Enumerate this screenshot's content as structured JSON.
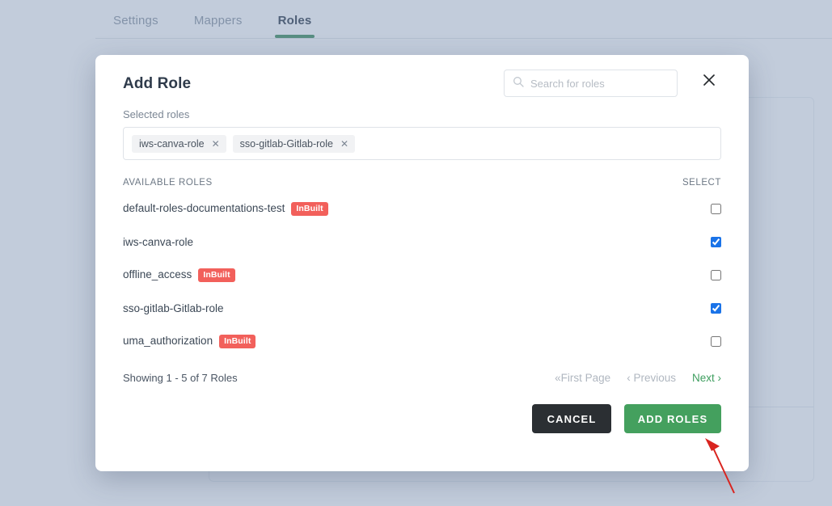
{
  "background": {
    "tabs": [
      {
        "label": "Settings",
        "active": false
      },
      {
        "label": "Mappers",
        "active": false
      },
      {
        "label": "Roles",
        "active": true
      }
    ],
    "accent_color": "#3e8e5e"
  },
  "modal": {
    "title": "Add Role",
    "close_icon": "close-icon",
    "search": {
      "icon": "search-icon",
      "placeholder": "Search for roles",
      "value": ""
    },
    "selected": {
      "label": "Selected roles",
      "chips": [
        {
          "label": "iws-canva-role",
          "remove_icon": "close-icon"
        },
        {
          "label": "sso-gitlab-Gitlab-role",
          "remove_icon": "close-icon"
        }
      ]
    },
    "table": {
      "columns": [
        "AVAILABLE ROLES",
        "SELECT"
      ],
      "rows": [
        {
          "name": "default-roles-documentations-test",
          "badge": "InBuilt",
          "checked": false
        },
        {
          "name": "iws-canva-role",
          "badge": "",
          "checked": true
        },
        {
          "name": "offline_access",
          "badge": "InBuilt",
          "checked": false
        },
        {
          "name": "sso-gitlab-Gitlab-role",
          "badge": "",
          "checked": true
        },
        {
          "name": "uma_authorization",
          "badge": "InBuilt",
          "checked": false
        }
      ],
      "badge_color": "#f2605b",
      "checked_color": "#1a73e8"
    },
    "pagination": {
      "showing": "Showing 1 - 5 of 7 Roles",
      "first_page": "First Page",
      "previous": "Previous",
      "next": "Next",
      "first_page_enabled": false,
      "previous_enabled": false,
      "next_enabled": true
    },
    "actions": {
      "cancel": "CANCEL",
      "submit": "ADD ROLES",
      "cancel_color": "#2b2f33",
      "submit_color": "#44a05e"
    }
  },
  "annotation": {
    "arrow_color": "#d9241f",
    "points_to": "ADD ROLES"
  }
}
